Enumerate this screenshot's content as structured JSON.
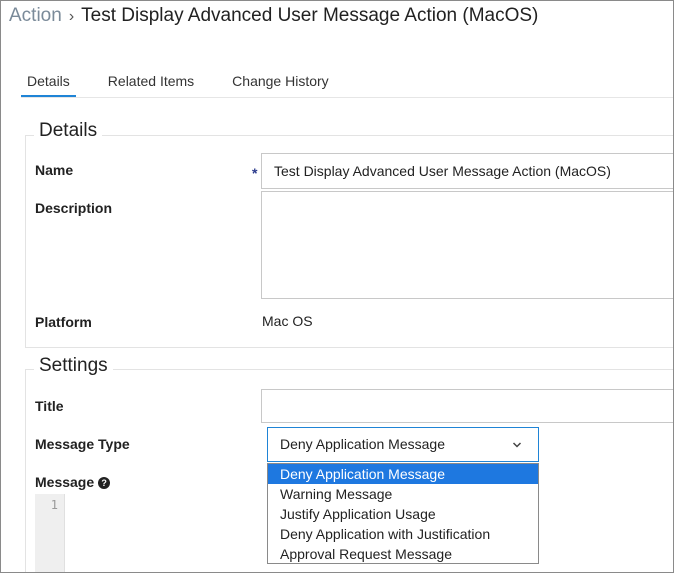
{
  "breadcrumb": {
    "parent": "Action",
    "separator": "›",
    "title": "Test Display Advanced User Message Action (MacOS)"
  },
  "tabs": [
    {
      "label": "Details",
      "active": true
    },
    {
      "label": "Related Items",
      "active": false
    },
    {
      "label": "Change History",
      "active": false
    }
  ],
  "details": {
    "heading": "Details",
    "name_label": "Name",
    "required_marker": "*",
    "name_value": "Test Display Advanced User Message Action (MacOS)",
    "description_label": "Description",
    "description_value": "",
    "platform_label": "Platform",
    "platform_value": "Mac OS"
  },
  "settings": {
    "heading": "Settings",
    "title_label": "Title",
    "title_value": "",
    "message_type_label": "Message Type",
    "message_type_value": "Deny Application Message",
    "message_type_options": [
      "Deny Application Message",
      "Warning Message",
      "Justify Application Usage",
      "Deny Application with Justification",
      "Approval Request Message"
    ],
    "selected_option_index": 0,
    "message_label": "Message",
    "help_icon_glyph": "?",
    "chevron_icon": "chevron-down-icon",
    "editor_line_number": "1"
  },
  "colors": {
    "accent": "#1f84d6",
    "option_highlight": "#1e78e0",
    "breadcrumb_link": "#7a8a99"
  }
}
